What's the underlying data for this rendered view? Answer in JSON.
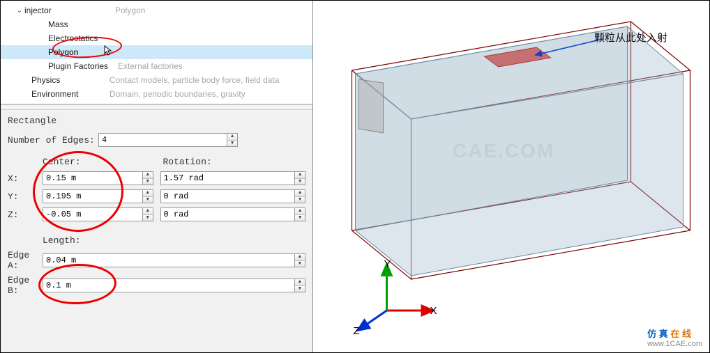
{
  "tree": {
    "root": {
      "label": "injector",
      "desc": "Polygon"
    },
    "children": [
      {
        "label": "Mass",
        "desc": ""
      },
      {
        "label": "Electrostatics",
        "desc": ""
      },
      {
        "label": "Polygon",
        "desc": "",
        "selected": true
      },
      {
        "label": "Plugin Factories",
        "desc": "External factories"
      }
    ],
    "siblings": [
      {
        "label": "Physics",
        "desc": "Contact models, particle body force, field data"
      },
      {
        "label": "Environment",
        "desc": "Domain, periodic boundaries, gravity"
      }
    ]
  },
  "props": {
    "title": "Rectangle",
    "edges_label": "Number of Edges:",
    "edges_value": "4",
    "center_label": "Center:",
    "rotation_label": "Rotation:",
    "x_label": "X:",
    "x_value": "0.15 m",
    "rx_value": "1.57 rad",
    "y_label": "Y:",
    "y_value": "0.195 m",
    "ry_value": "0 rad",
    "z_label": "Z:",
    "z_value": "-0.05 m",
    "rz_value": "0 rad",
    "length_label": "Length:",
    "ea_label": "Edge A:",
    "ea_value": "0.04 m",
    "eb_label": "Edge B:",
    "eb_value": "0.1 m"
  },
  "viewport": {
    "annotation": "颗粒从此处入射",
    "axes": {
      "x": "X",
      "y": "Y",
      "z": "Z"
    },
    "watermark_bg": "CAE.COM",
    "watermark": {
      "left": "仿 真",
      "right": "在 线",
      "url": "www.1CAE.com"
    }
  }
}
